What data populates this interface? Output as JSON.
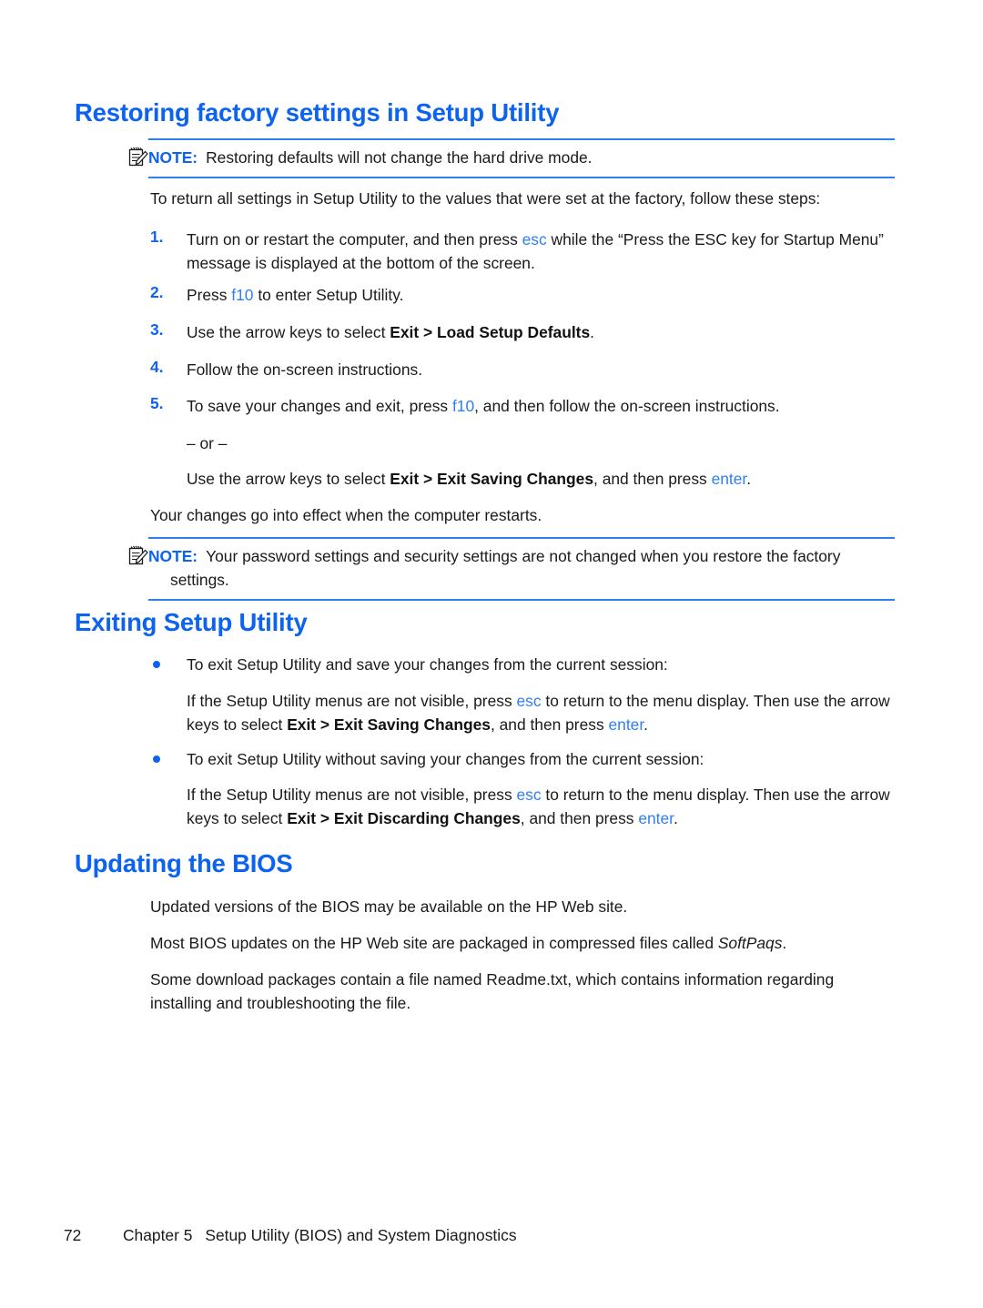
{
  "document": {
    "accent_blue": "#0c63f0",
    "key_blue": "#2f80ed",
    "rule_blue": "#2f80ed",
    "text_color": "#1a1a1a"
  },
  "section_restore": {
    "heading": "Restoring factory settings in Setup Utility",
    "note": {
      "label": "NOTE:",
      "icon": "note-pencil-icon",
      "text": "Restoring defaults will not change the hard drive mode."
    },
    "intro": "To return all settings in Setup Utility to the values that were set at the factory, follow these steps:",
    "steps": [
      {
        "number": "1.",
        "parts": [
          {
            "type": "text",
            "value": "Turn on or restart the computer, and then press "
          },
          {
            "type": "key",
            "value": "esc"
          },
          {
            "type": "text",
            "value": " while the “Press the ESC key for Startup Menu” message is displayed at the bottom of the screen."
          }
        ]
      },
      {
        "number": "2.",
        "parts": [
          {
            "type": "text",
            "value": "Press "
          },
          {
            "type": "key",
            "value": "f10"
          },
          {
            "type": "text",
            "value": " to enter Setup Utility."
          }
        ]
      },
      {
        "number": "3.",
        "parts": [
          {
            "type": "text",
            "value": "Use the arrow keys to select "
          },
          {
            "type": "bold",
            "value": "Exit > Load Setup Defaults"
          },
          {
            "type": "text",
            "value": "."
          }
        ]
      },
      {
        "number": "4.",
        "parts": [
          {
            "type": "text",
            "value": "Follow the on-screen instructions."
          }
        ]
      },
      {
        "number": "5.",
        "parts": [
          {
            "type": "text",
            "value": "To save your changes and exit, press "
          },
          {
            "type": "key",
            "value": "f10"
          },
          {
            "type": "text",
            "value": ", and then follow the on-screen instructions."
          }
        ]
      }
    ],
    "or_divider": "– or –",
    "alternative": [
      {
        "type": "text",
        "value": "Use the arrow keys to select "
      },
      {
        "type": "bold",
        "value": "Exit > Exit Saving Changes"
      },
      {
        "type": "text",
        "value": ", and then press "
      },
      {
        "type": "key",
        "value": "enter"
      },
      {
        "type": "text",
        "value": "."
      }
    ],
    "effect_note": "Your changes go into effect when the computer restarts.",
    "note2": {
      "label": "NOTE:",
      "icon": "note-pencil-icon",
      "text": "Your password settings and security settings are not changed when you restore the factory settings."
    }
  },
  "section_exiting": {
    "heading": "Exiting Setup Utility",
    "bullets": [
      {
        "lead": "To exit Setup Utility and save your changes from the current session:",
        "detail": [
          {
            "type": "text",
            "value": "If the Setup Utility menus are not visible, press "
          },
          {
            "type": "key",
            "value": "esc"
          },
          {
            "type": "text",
            "value": " to return to the menu display. Then use the arrow keys to select "
          },
          {
            "type": "bold",
            "value": "Exit > Exit Saving Changes"
          },
          {
            "type": "text",
            "value": ", and then press "
          },
          {
            "type": "key",
            "value": "enter"
          },
          {
            "type": "text",
            "value": "."
          }
        ]
      },
      {
        "lead": "To exit Setup Utility without saving your changes from the current session:",
        "detail": [
          {
            "type": "text",
            "value": "If the Setup Utility menus are not visible, press "
          },
          {
            "type": "key",
            "value": "esc"
          },
          {
            "type": "text",
            "value": " to return to the menu display. Then use the arrow keys to select "
          },
          {
            "type": "bold",
            "value": "Exit > Exit Discarding Changes"
          },
          {
            "type": "text",
            "value": ", and then press "
          },
          {
            "type": "key",
            "value": "enter"
          },
          {
            "type": "text",
            "value": "."
          }
        ]
      }
    ]
  },
  "section_bios": {
    "heading": "Updating the BIOS",
    "paragraphs": [
      [
        {
          "type": "text",
          "value": "Updated versions of the BIOS may be available on the HP Web site."
        }
      ],
      [
        {
          "type": "text",
          "value": "Most BIOS updates on the HP Web site are packaged in compressed files called "
        },
        {
          "type": "italic",
          "value": "SoftPaqs"
        },
        {
          "type": "text",
          "value": "."
        }
      ],
      [
        {
          "type": "text",
          "value": "Some download packages contain a file named Readme.txt, which contains information regarding installing and troubleshooting the file."
        }
      ]
    ]
  },
  "footer": {
    "page_number": "72",
    "chapter": "Chapter 5",
    "title": "Setup Utility (BIOS) and System Diagnostics"
  }
}
